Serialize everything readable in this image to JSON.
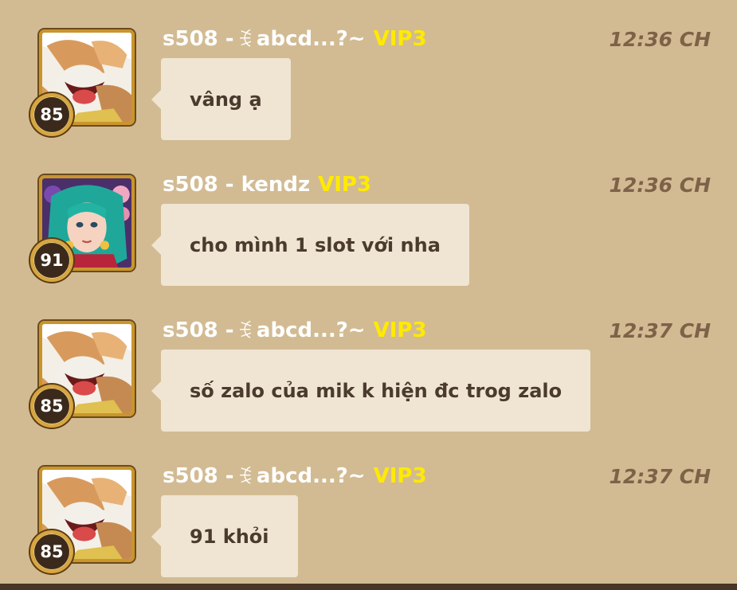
{
  "messages": [
    {
      "avatar": "luffy-gear5-avatar",
      "level": "85",
      "name": "s508 - ",
      "name_symbol": "ꉂ",
      "name_suffix": " abcd...?~",
      "vip": "VIP3",
      "time": "12:36 CH",
      "text": "vâng ạ"
    },
    {
      "avatar": "green-hair-woman-avatar",
      "level": "91",
      "name": "s508 - kendz",
      "name_symbol": "",
      "name_suffix": "",
      "vip": "VIP3",
      "time": "12:36 CH",
      "text": "cho mình 1 slot với nha"
    },
    {
      "avatar": "luffy-gear5-avatar",
      "level": "85",
      "name": "s508 - ",
      "name_symbol": "ꉂ",
      "name_suffix": " abcd...?~",
      "vip": "VIP3",
      "time": "12:37 CH",
      "text": "số zalo của mik k hiện đc trog zalo"
    },
    {
      "avatar": "luffy-gear5-avatar",
      "level": "85",
      "name": "s508 - ",
      "name_symbol": "ꉂ",
      "name_suffix": " abcd...?~",
      "vip": "VIP3",
      "time": "12:37 CH",
      "text": "91 khỏi"
    }
  ],
  "colors": {
    "background": "#d2bb93",
    "bubble": "#f0e5d2",
    "vip": "#ffea00",
    "time": "#7e6248"
  }
}
